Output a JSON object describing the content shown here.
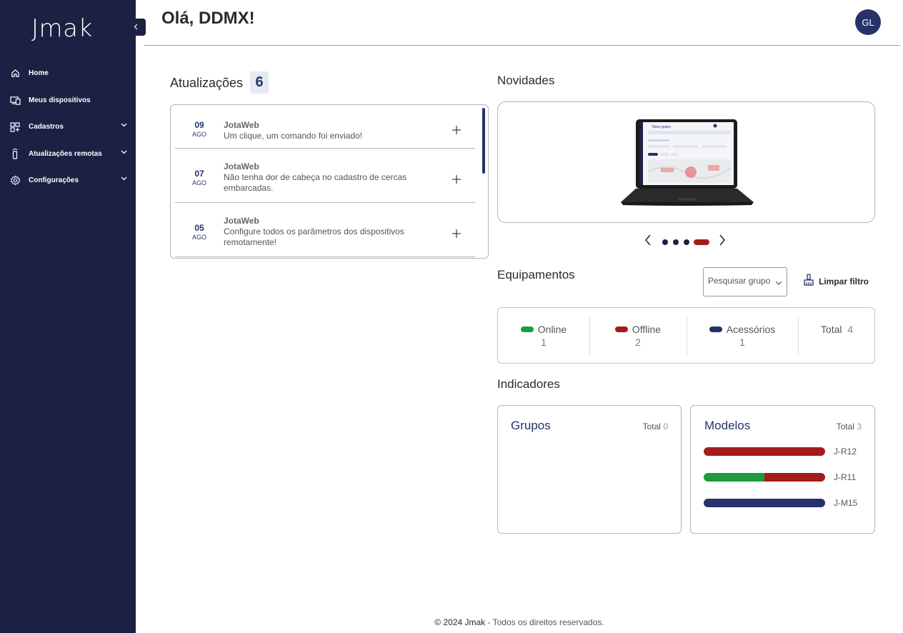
{
  "sidebar": {
    "logo": "Jmak",
    "items": [
      {
        "label": "Home",
        "icon": "home-icon",
        "has_chevron": false
      },
      {
        "label": "Meus dispositivos",
        "icon": "devices-icon",
        "has_chevron": false
      },
      {
        "label": "Cadastros",
        "icon": "grid-add-icon",
        "has_chevron": true
      },
      {
        "label": "Atualizações remotas",
        "icon": "remote-update-icon",
        "has_chevron": true
      },
      {
        "label": "Configurações",
        "icon": "gear-icon",
        "has_chevron": true
      }
    ]
  },
  "header": {
    "greeting": "Olá, DDMX!",
    "avatar_initials": "GL"
  },
  "updates": {
    "title": "Atualizações",
    "count": "6",
    "items": [
      {
        "day": "09",
        "month": "AGO",
        "source": "JotaWeb",
        "text": "Um clique, um comando foi enviado!"
      },
      {
        "day": "07",
        "month": "AGO",
        "source": "JotaWeb",
        "text": "Não tenha dor de cabeça no cadastro de cercas embarcadas."
      },
      {
        "day": "05",
        "month": "AGO",
        "source": "JotaWeb",
        "text": "Configure todos os parâmetros dos dispositivos remotamente!"
      }
    ]
  },
  "news": {
    "title": "Novidades",
    "slide_count": 4,
    "active_slide": 4,
    "laptop_screen_title": "Novo grupo"
  },
  "equipment": {
    "title": "Equipamentos",
    "search_placeholder": "Pesquisar grupo",
    "clear_filter": "Limpar filtro",
    "stats": [
      {
        "label": "Online",
        "value": "1",
        "color": "#1e9b3c"
      },
      {
        "label": "Offline",
        "value": "2",
        "color": "#a51c1c"
      },
      {
        "label": "Acessórios",
        "value": "1",
        "color": "#26336a"
      }
    ],
    "total_label": "Total",
    "total_value": "4"
  },
  "indicators": {
    "title": "Indicadores",
    "groups": {
      "title": "Grupos",
      "total_label": "Total",
      "total_value": "0"
    },
    "models": {
      "title": "Modelos",
      "total_label": "Total",
      "total_value": "3",
      "items": [
        {
          "label": "J-R12",
          "segments": [
            {
              "fraction": 1.0,
              "color": "#a51c1c"
            }
          ]
        },
        {
          "label": "J-R11",
          "segments": [
            {
              "fraction": 0.5,
              "color": "#1e9b3c"
            },
            {
              "fraction": 0.5,
              "color": "#a51c1c"
            }
          ]
        },
        {
          "label": "J-M15",
          "segments": [
            {
              "fraction": 1.0,
              "color": "#26336a"
            }
          ]
        }
      ]
    }
  },
  "footer": {
    "copyright": "© 2024 Jmak",
    "rights": " - Todos os direitos reservados."
  }
}
